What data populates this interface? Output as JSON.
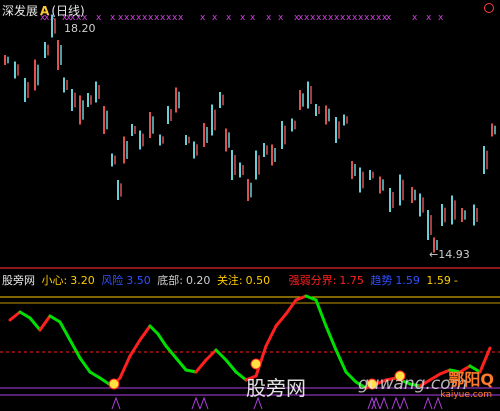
{
  "header": {
    "name": "深发展",
    "flag": "A",
    "period": "(日线)"
  },
  "price": {
    "high_label": "18.20",
    "low_label": "14.93"
  },
  "indicator": {
    "source": "股旁网",
    "caution_label": "小心:",
    "caution_value": "3.20",
    "risk_label": "风险",
    "risk_value": "3.50",
    "bottom_label": "底部:",
    "bottom_value": "0.20",
    "watch_label": "关注:",
    "watch_value": "0.50",
    "bound_label": "强弱分界:",
    "bound_value": "1.75",
    "trend_label": "趋势",
    "trend_value": "1.59",
    "trend_value2": "1.59",
    "dash": "-"
  },
  "watermark": {
    "text": "股旁网",
    "url": "guwang.com",
    "logo_main": "鄂阳Q",
    "logo_sub": "kaiyue.com"
  },
  "colors": {
    "up": "#e05050",
    "down": "#66d0d8",
    "magenta": "#d040e0",
    "yellow": "#ffcc00",
    "green": "#00e000",
    "red": "#ff2020",
    "purple": "#b040e0",
    "blue": "#3050ff"
  }
}
